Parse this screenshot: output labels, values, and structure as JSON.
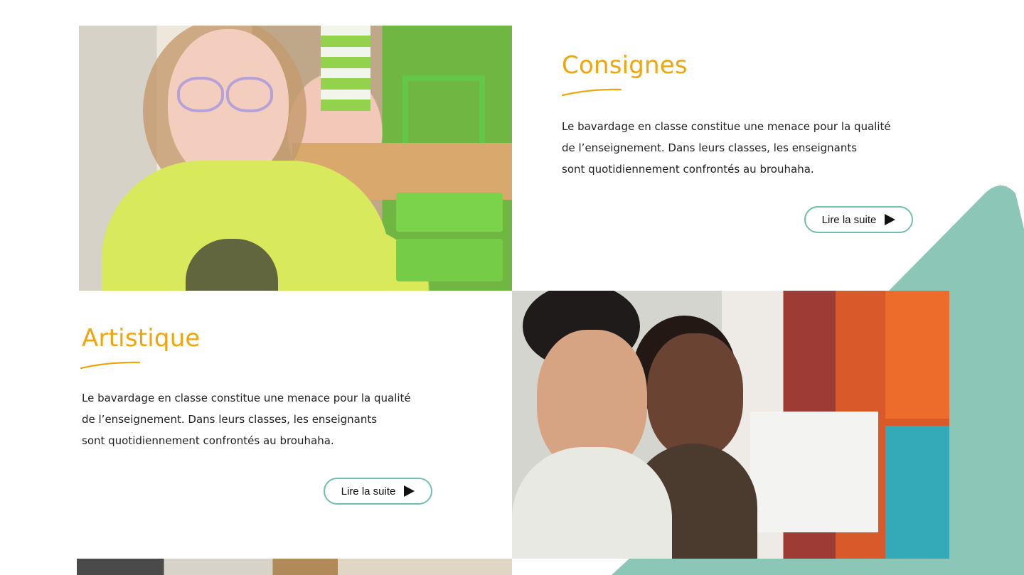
{
  "colors": {
    "accent": "#efa50d",
    "teal": "#8cc6b6",
    "button_border": "#6fc0b0",
    "text": "#1f1f1f"
  },
  "sections": [
    {
      "title": "Consignes",
      "lines": [
        "Le bavardage en classe constitue une menace pour la qualité",
        "de l’enseignement. Dans leurs classes, les enseignants",
        "sont quotidiennement confrontés au brouhaha."
      ],
      "button_label": "Lire la suite",
      "button_icon": "play-icon"
    },
    {
      "title": "Artistique",
      "lines": [
        "Le bavardage en classe constitue une menace pour la qualité",
        "de l’enseignement. Dans leurs classes, les enseignants",
        "sont quotidiennement confrontés au brouhaha."
      ],
      "button_label": "Lire la suite",
      "button_icon": "play-icon"
    }
  ]
}
